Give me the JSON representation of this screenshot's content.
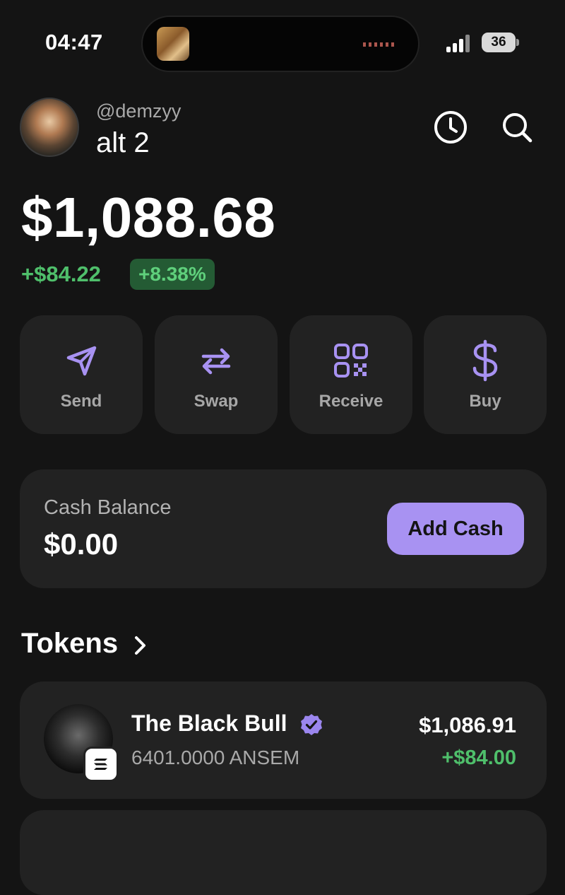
{
  "status_bar": {
    "time": "04:47",
    "battery": "36"
  },
  "profile": {
    "handle": "@demzyy",
    "account_name": "alt 2",
    "icons": [
      "clock-icon",
      "search-icon"
    ]
  },
  "portfolio": {
    "balance": "$1,088.68",
    "change_amount": "+$84.22",
    "change_percent": "+8.38%"
  },
  "actions": [
    {
      "label": "Send",
      "icon": "send-icon"
    },
    {
      "label": "Swap",
      "icon": "swap-icon"
    },
    {
      "label": "Receive",
      "icon": "qr-code-icon"
    },
    {
      "label": "Buy",
      "icon": "dollar-icon"
    }
  ],
  "cash": {
    "label": "Cash Balance",
    "value": "$0.00",
    "button_label": "Add Cash"
  },
  "tokens": {
    "title": "Tokens",
    "items": [
      {
        "name": "The Black Bull",
        "amount": "6401.0000 ANSEM",
        "value": "$1,086.91",
        "change": "+$84.00",
        "verified": true,
        "chain_icon": "solana-icon"
      }
    ]
  },
  "colors": {
    "background": "#141414",
    "card": "#222222",
    "accent": "#a892f2",
    "positive": "#4fbf6b"
  }
}
